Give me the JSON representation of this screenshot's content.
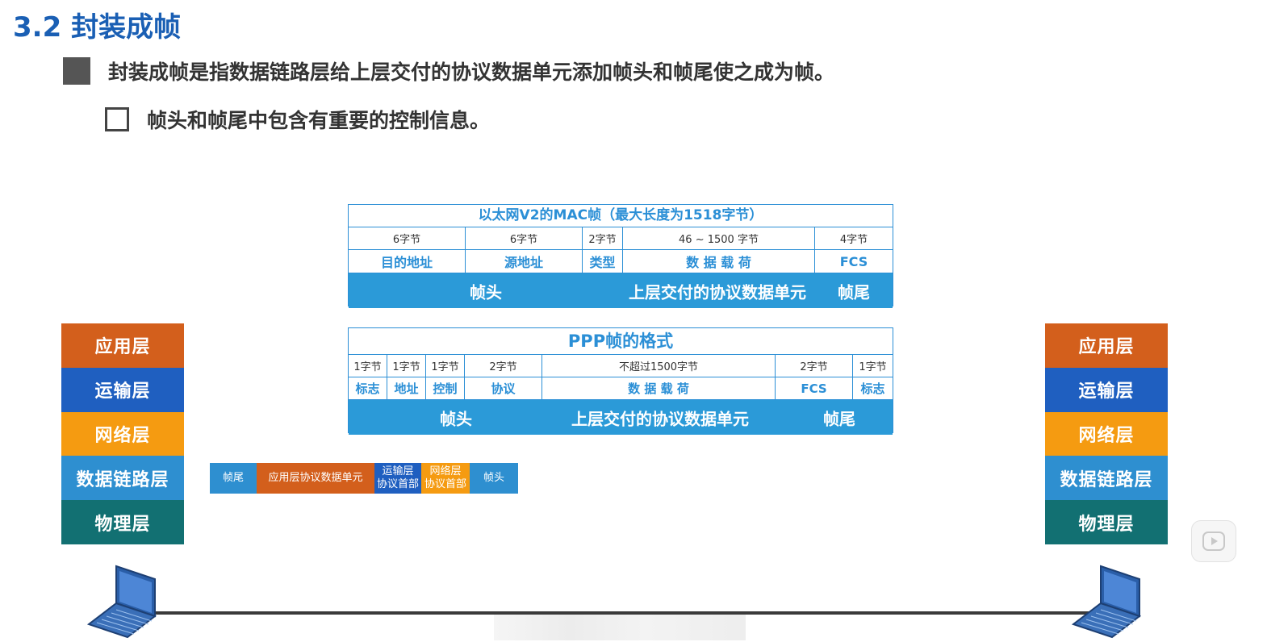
{
  "title": "3.2 封装成帧",
  "bullets": {
    "main": "封装成帧是指数据链路层给上层交付的协议数据单元添加帧头和帧尾使之成为帧。",
    "sub": "帧头和帧尾中包含有重要的控制信息。"
  },
  "mac_frame": {
    "caption": "以太网V2的MAC帧（最大长度为1518字节）",
    "sizes": [
      "6字节",
      "6字节",
      "2字节",
      "46 ~ 1500 字节",
      "4字节"
    ],
    "fields": [
      "目的地址",
      "源地址",
      "类型",
      "数 据 载 荷",
      "FCS"
    ],
    "bar": {
      "head": "帧头",
      "payload": "上层交付的协议数据单元",
      "tail": "帧尾"
    }
  },
  "ppp_frame": {
    "caption": "PPP帧的格式",
    "sizes": [
      "1字节",
      "1字节",
      "1字节",
      "2字节",
      "不超过1500字节",
      "2字节",
      "1字节"
    ],
    "fields": [
      "标志",
      "地址",
      "控制",
      "协议",
      "数 据 载 荷",
      "FCS",
      "标志"
    ],
    "bar": {
      "head": "帧头",
      "payload": "上层交付的协议数据单元",
      "tail": "帧尾"
    }
  },
  "stack_left": [
    "应用层",
    "运输层",
    "网络层",
    "数据链路层",
    "物理层"
  ],
  "stack_right": [
    "应用层",
    "运输层",
    "网络层",
    "数据链路层",
    "物理层"
  ],
  "packet": {
    "trailer": "帧尾",
    "app_data": "应用层协议数据单元",
    "transport_header": "运输层\n协议首部",
    "network_header": "网络层\n协议首部",
    "header": "帧头"
  },
  "colors": {
    "title": "#1a5fb4",
    "frame_blue": "#2b9ad8",
    "application": "#d35f1c",
    "transport": "#1f5fc0",
    "network": "#f59b11",
    "datalink": "#2e8fd0",
    "physical": "#127072"
  },
  "icons": [
    "laptop-icon",
    "play-icon"
  ]
}
